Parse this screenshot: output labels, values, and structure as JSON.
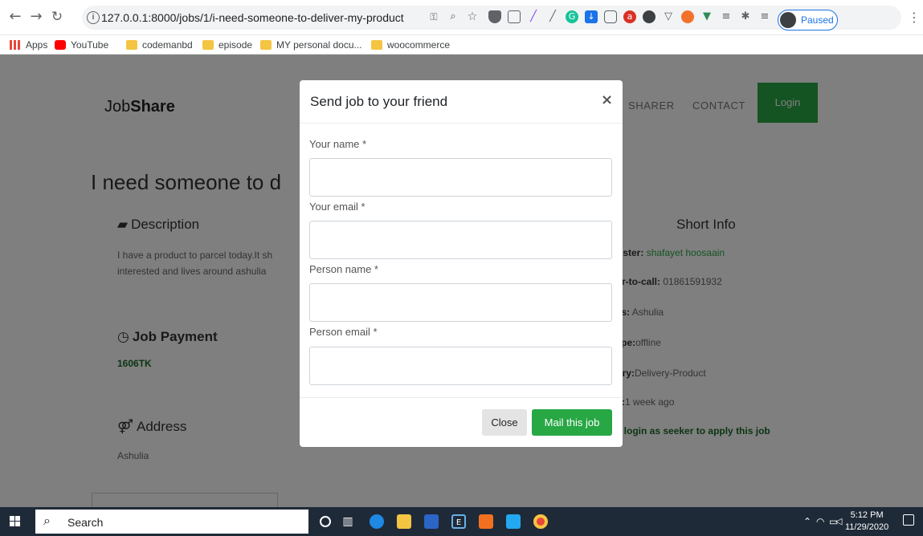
{
  "browser": {
    "url": "127.0.0.1:8000/jobs/1/i-need-someone-to-deliver-my-product",
    "profile_status": "Paused"
  },
  "bookmarks": [
    {
      "label": "Apps"
    },
    {
      "label": "YouTube"
    },
    {
      "label": "codemanbd"
    },
    {
      "label": "episode"
    },
    {
      "label": "MY personal docu..."
    },
    {
      "label": "woocommerce"
    }
  ],
  "site": {
    "brand_light": "Job",
    "brand_bold": "Share",
    "nav": {
      "sharer": "SHARER",
      "contact": "CONTACT",
      "login": "Login"
    }
  },
  "job": {
    "title": "I need someone to d",
    "description_heading": "Description",
    "description_lines": [
      "I have a product to parcel today.It sh",
      "interested and lives around ashulia"
    ],
    "payment_heading": "Job Payment",
    "payment_value": "1606TK",
    "address_heading": "Address",
    "address_value": "Ashulia"
  },
  "short_info": {
    "heading": "Short Info",
    "poster_label": "Poster:",
    "poster_value": "shafayet hoosaain",
    "phone_label": "ber-to-call:",
    "phone_value": "01861591932",
    "address_label": "ess:",
    "address_value": "Ashulia",
    "type_label": "Type:",
    "type_value": "offline",
    "category_label": "gory:",
    "category_value": "Delivery-Product",
    "posted_label": "ed:",
    "posted_value": "1 week ago",
    "login_note": "se login as seeker to apply this job"
  },
  "modal": {
    "title": "Send job to your friend",
    "close_x": "×",
    "fields": [
      {
        "label": "Your name *",
        "value": ""
      },
      {
        "label": "Your email *",
        "value": ""
      },
      {
        "label": "Person name *",
        "value": ""
      },
      {
        "label": "Person email *",
        "value": ""
      }
    ],
    "close_label": "Close",
    "submit_label": "Mail this job"
  },
  "taskbar": {
    "search_label": "Search",
    "time": "5:12 PM",
    "date": "11/29/2020"
  },
  "colors": {
    "accent": "#28a745",
    "backdrop": "rgba(0,0,0,0.5)",
    "taskbar": "#1f2a38"
  }
}
